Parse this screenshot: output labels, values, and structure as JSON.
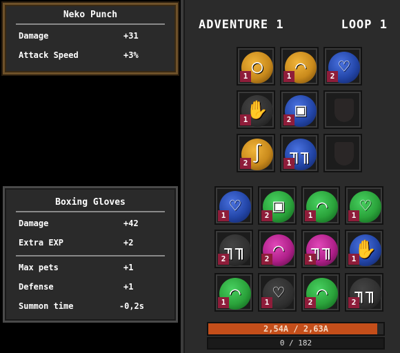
{
  "colors": {
    "gold_orb": "#c98a1c",
    "blue_orb": "#2346a8",
    "green_orb": "#2aa23a",
    "magenta_orb": "#b0208a",
    "dark_orb": "#2f2f2f",
    "hp_fill": "#c44e1a",
    "badge": "#8e1d3a"
  },
  "tooltip_top": {
    "title": "Neko Punch",
    "stats": [
      {
        "label": "Damage",
        "value": "+31"
      },
      {
        "label": "Attack Speed",
        "value": "+3%"
      }
    ]
  },
  "tooltip_bottom": {
    "title": "Boxing Gloves",
    "stats_a": [
      {
        "label": "Damage",
        "value": "+42"
      },
      {
        "label": "Extra EXP",
        "value": "+2"
      }
    ],
    "stats_b": [
      {
        "label": "Max pets",
        "value": "+1"
      },
      {
        "label": "Defense",
        "value": "+1"
      },
      {
        "label": "Summon time",
        "value": "-0,2s"
      }
    ]
  },
  "panel": {
    "adventure_label": "ADVENTURE 1",
    "loop_label": "LOOP 1"
  },
  "equipped": [
    {
      "icon": "ring-icon",
      "orb": "gold",
      "glyph": "◯",
      "count": "1"
    },
    {
      "icon": "cat-ears-icon",
      "orb": "gold",
      "glyph": "⌒",
      "count": "1"
    },
    {
      "icon": "necklace-icon",
      "orb": "blue",
      "glyph": "♡",
      "count": "2"
    },
    {
      "icon": "glove-icon",
      "orb": "dark",
      "glyph": "✋",
      "count": "1"
    },
    {
      "icon": "armor-icon",
      "orb": "blue",
      "glyph": "▣",
      "count": "2"
    },
    {
      "icon": "empty-shield-icon",
      "orb": "none",
      "glyph": "",
      "count": ""
    },
    {
      "icon": "hook-icon",
      "orb": "gold",
      "glyph": "∫",
      "count": "2"
    },
    {
      "icon": "boots-icon",
      "orb": "blue",
      "glyph": "╖╖",
      "count": "1"
    },
    {
      "icon": "empty-slot-icon",
      "orb": "none",
      "glyph": "",
      "count": ""
    }
  ],
  "inventory": [
    {
      "icon": "necklace-icon",
      "orb": "blue",
      "glyph": "♡",
      "count": "1"
    },
    {
      "icon": "armor-icon",
      "orb": "green",
      "glyph": "▣",
      "count": "2"
    },
    {
      "icon": "cat-ears-icon",
      "orb": "green",
      "glyph": "⌒",
      "count": "1"
    },
    {
      "icon": "necklace-icon",
      "orb": "green",
      "glyph": "♡",
      "count": "1"
    },
    {
      "icon": "boots-icon",
      "orb": "dark",
      "glyph": "╖╖",
      "count": "2"
    },
    {
      "icon": "cat-ears-icon",
      "orb": "magenta",
      "glyph": "⌒",
      "count": "2"
    },
    {
      "icon": "boots-icon",
      "orb": "magenta",
      "glyph": "╖╖",
      "count": "1"
    },
    {
      "icon": "glove-icon",
      "orb": "blue",
      "glyph": "✋",
      "count": "1"
    },
    {
      "icon": "cat-ears-icon",
      "orb": "green",
      "glyph": "⌒",
      "count": "1"
    },
    {
      "icon": "necklace-icon",
      "orb": "dark",
      "glyph": "♡",
      "count": "1"
    },
    {
      "icon": "cat-ears-icon",
      "orb": "green",
      "glyph": "⌒",
      "count": "2"
    },
    {
      "icon": "boots-icon",
      "orb": "dark",
      "glyph": "╖╖",
      "count": "2"
    }
  ],
  "hp": {
    "text": "2,54A / 2,63A",
    "fraction": 0.966
  },
  "xp": {
    "text": "0 / 182",
    "fraction": 0.0
  }
}
